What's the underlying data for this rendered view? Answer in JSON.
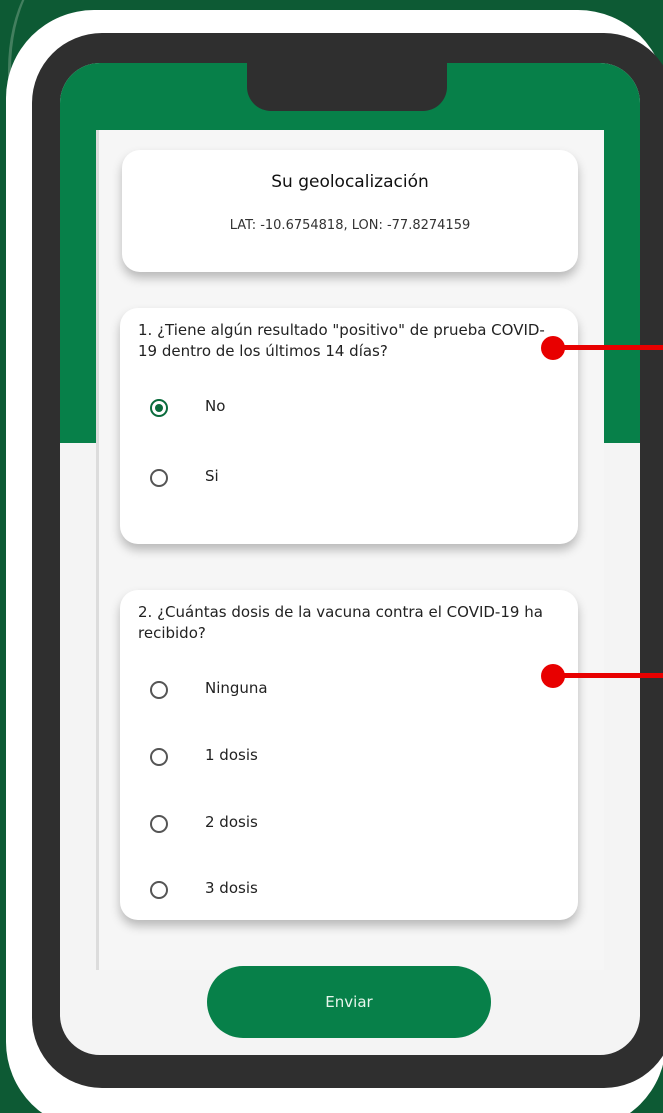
{
  "geo": {
    "title": "Su geolocalización",
    "coords": "LAT: -10.6754818, LON: -77.8274159"
  },
  "q1": {
    "text": "1. ¿Tiene algún resultado \"positivo\" de prueba COVID-19 dentro de los últimos 14 días?",
    "options": [
      {
        "label": "No",
        "checked": true
      },
      {
        "label": "Si",
        "checked": false
      }
    ]
  },
  "q2": {
    "text": "2. ¿Cuántas dosis de la vacuna contra el COVID-19 ha recibido?",
    "options": [
      {
        "label": "Ninguna",
        "checked": false
      },
      {
        "label": "1 dosis",
        "checked": false
      },
      {
        "label": "2 dosis",
        "checked": false
      },
      {
        "label": "3 dosis",
        "checked": false
      }
    ]
  },
  "submit": {
    "label": "Enviar"
  },
  "colors": {
    "primary_green": "#078049",
    "marker_red": "#e80000"
  }
}
